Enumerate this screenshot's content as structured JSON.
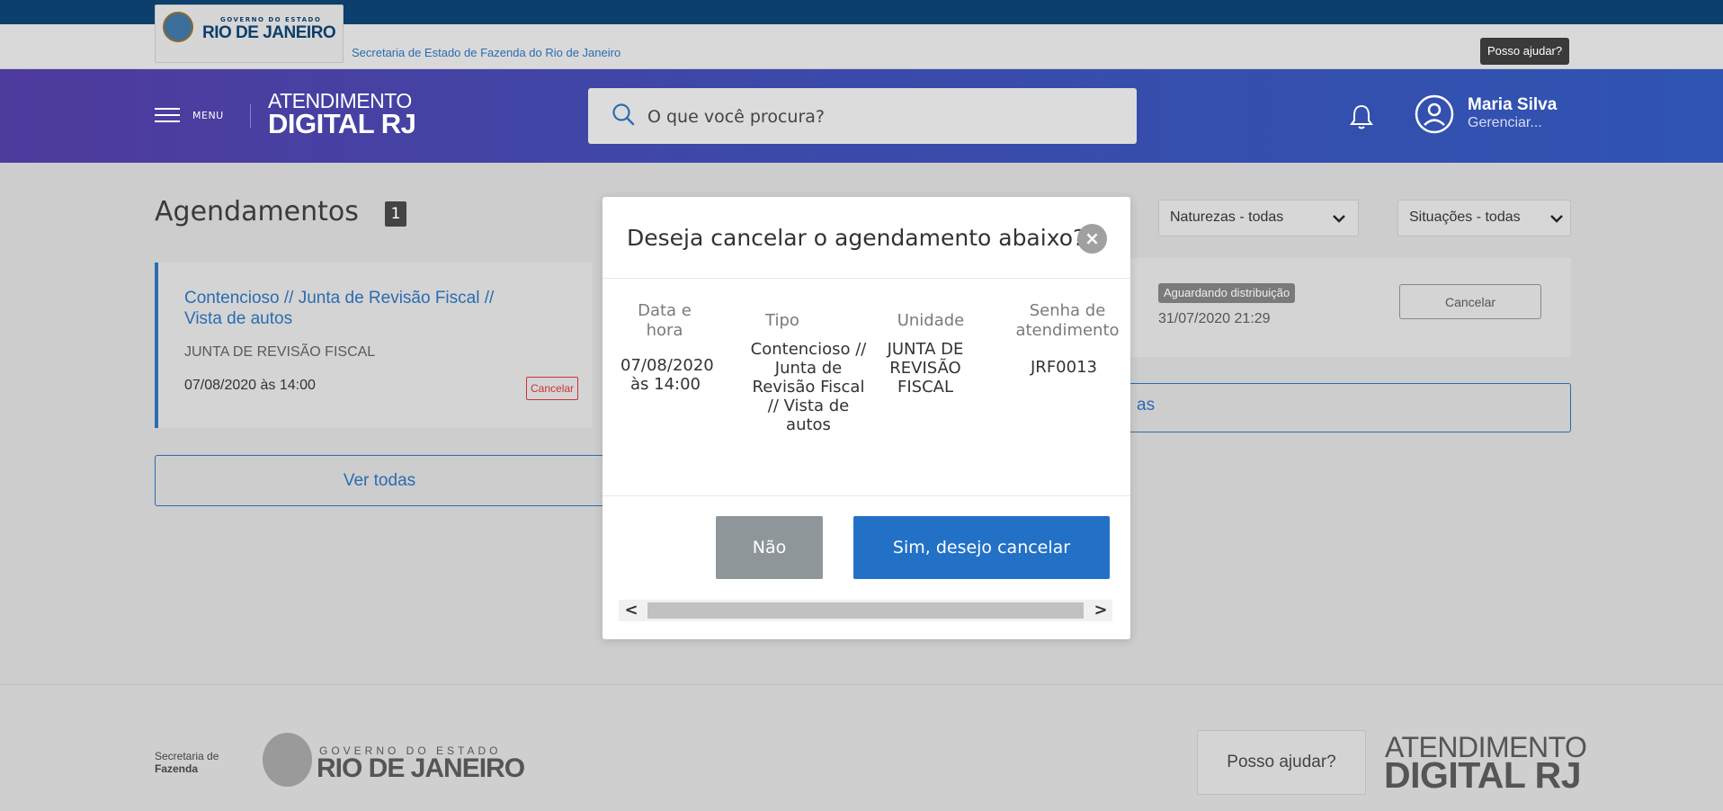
{
  "topbar": {
    "logo_small": "GOVERNO DO ESTADO",
    "logo_big": "RIO DE JANEIRO",
    "secretaria_link": "Secretaria de Estado de Fazenda do Rio de Janeiro",
    "help_badge": "Posso ajudar?"
  },
  "header": {
    "menu_label": "MENU",
    "brand_line1": "ATENDIMENTO",
    "brand_line2": "DIGITAL RJ",
    "search_placeholder": "O que você procura?",
    "user_name": "Maria Silva",
    "user_manage": "Gerenciar..."
  },
  "main": {
    "title": "Agendamentos",
    "count": "1",
    "appointment": {
      "link": "Contencioso // Junta de Revisão Fiscal // Vista de autos",
      "unit": "JUNTA DE REVISÃO FISCAL",
      "date": "07/08/2020 às 14:00",
      "cancel_label": "Cancelar"
    },
    "see_all_left": "Ver todas",
    "filters": {
      "naturezas": "Naturezas - todas",
      "situacoes": "Situações - todas"
    },
    "request": {
      "status": "Aguardando distribuição",
      "date": "31/07/2020 21:29",
      "cancel_label": "Cancelar"
    },
    "see_all_right_fragment": "as"
  },
  "modal": {
    "title": "Deseja cancelar o agendamento abaixo?",
    "columns": [
      "Data e hora",
      "Tipo",
      "Unidade",
      "Senha de atendimento"
    ],
    "row": {
      "date": "07/08/2020 às 14:00",
      "tipo": "Contencioso // Junta de Revisão Fiscal // Vista de autos",
      "unidade": "JUNTA DE REVISÃO FISCAL",
      "senha": "JRF0013"
    },
    "btn_no": "Não",
    "btn_yes": "Sim, desejo cancelar"
  },
  "footer": {
    "secretaria_l1": "Secretaria de",
    "secretaria_l2": "Fazenda",
    "gov_small": "GOVERNO DO ESTADO",
    "gov_big": "RIO DE JANEIRO",
    "help": "Posso ajudar?",
    "brand_line1": "ATENDIMENTO",
    "brand_line2": "DIGITAL RJ"
  },
  "colors": {
    "accent": "#2271c7",
    "header_start": "#4f3a9d",
    "header_end": "#2f54b2",
    "danger": "#cc3333"
  },
  "icons": [
    "menu-icon",
    "search-icon",
    "bell-icon",
    "avatar-icon",
    "close-icon",
    "chevron-down-icon"
  ]
}
